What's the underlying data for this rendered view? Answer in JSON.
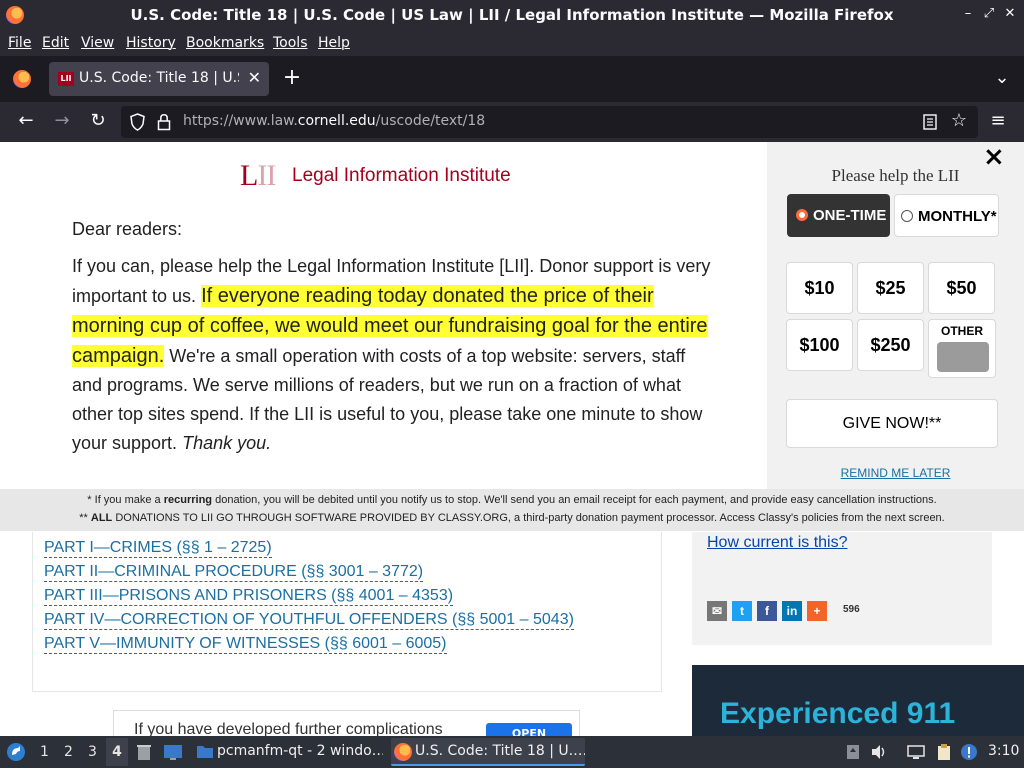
{
  "window": {
    "title": "U.S. Code: Title 18 | U.S. Code | US Law | LII / Legal Information Institute — Mozilla Firefox"
  },
  "menubar": {
    "items": [
      "File",
      "Edit",
      "View",
      "History",
      "Bookmarks",
      "Tools",
      "Help"
    ]
  },
  "tabs": [
    {
      "label": "U.S. Code: Title 18 | U.S. Code",
      "active": true
    }
  ],
  "navbar": {
    "url_prefix": "https://www.law.",
    "url_domain": "cornell.edu",
    "url_path": "/uscode/text/18"
  },
  "donation": {
    "logo_mark": "LII",
    "logo_name": "Legal Information Institute",
    "salutation": "Dear readers:",
    "body_intro": "If you can, please help the Legal Information Institute [LII]. Donor support is very important to us.",
    "body_highlight": "If everyone reading today donated the price of their morning cup of coffee, we would meet our fundraising goal for the entire campaign.",
    "body_rest": "We're a small operation with costs of a top website: servers, staff and programs. We serve millions of readers, but we run on a fraction of what other top sites spend. If the LII is useful to you, please take one minute to show your support.",
    "body_thanks": "Thank you.",
    "close_icon": "×",
    "panel_title": "Please help the LII",
    "one_time_label": "ONE-TIME",
    "monthly_label": "MONTHLY*",
    "amounts": [
      "$10",
      "$25",
      "$50",
      "$100",
      "$250"
    ],
    "other_label": "OTHER",
    "give_label": "GIVE NOW!**",
    "remind_label": "REMIND ME LATER",
    "footnote1_a": "* If you make a ",
    "footnote1_b": "recurring",
    "footnote1_c": " donation, you will be debited until you notify us to stop. We'll send you an email receipt for each payment, and provide easy cancellation instructions.",
    "footnote2_a": "** ",
    "footnote2_b": "ALL",
    "footnote2_c": " DONATIONS TO LII GO THROUGH SOFTWARE PROVIDED BY CLASSY.ORG, a third-party donation payment processor. Access Classy's policies from the next screen.",
    "accent_color": "#a4001d",
    "highlight_color": "#ffff33"
  },
  "page": {
    "toc": [
      "PART I—CRIMES (§§ 1 – 2725)",
      "PART II—CRIMINAL PROCEDURE (§§ 3001 – 3772)",
      "PART III—PRISONS AND PRISONERS (§§ 4001 – 4353)",
      "PART IV—CORRECTION OF YOUTHFUL OFFENDERS (§§ 5001 – 5043)",
      "PART V—IMMUNITY OF WITNESSES (§§ 6001 – 6005)"
    ],
    "how_current": "How current is this?",
    "share_count": "596",
    "promo_text": "Experienced 911",
    "ad_text": "If you have developed further complications",
    "ad_button": "OPEN"
  },
  "taskbar": {
    "workspaces": [
      "1",
      "2",
      "3",
      "4"
    ],
    "active_workspace": "4",
    "tasks": [
      {
        "label": "pcmanfm-qt - 2 windo…"
      },
      {
        "label": "U.S. Code: Title 18 | U.…"
      }
    ],
    "clock": "3:10"
  }
}
